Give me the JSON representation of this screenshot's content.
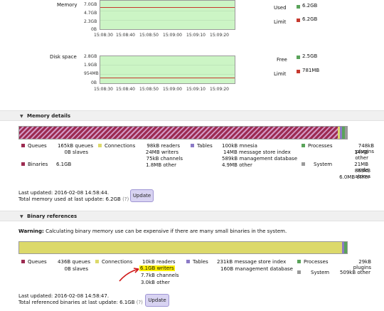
{
  "colors": {
    "queues": "#9c2b51",
    "binaries": "#9c2b51",
    "connections": "#dcd96a",
    "tables": "#8b7ac6",
    "processes": "#5aa35a",
    "system": "#9a9a9a",
    "plot_fill": "#ccf5c5",
    "limit_line": "#c6392e",
    "highlight": "#fff200",
    "arrow": "#d01818"
  },
  "memory_chart": {
    "label": "Memory",
    "yticks": [
      "7.0GB",
      "4.7GB",
      "2.3GB",
      "0B"
    ],
    "xticks": [
      "15:08:30",
      "15:08:40",
      "15:08:50",
      "15:09:00",
      "15:09:10",
      "15:09:20"
    ],
    "used_label": "Used",
    "used_value": "6.2GB",
    "limit_label": "Limit",
    "limit_value": "6.2GB"
  },
  "disk_chart": {
    "label": "Disk space",
    "yticks": [
      "2.8GB",
      "1.9GB",
      "954MB",
      "0B"
    ],
    "xticks": [
      "15:08:30",
      "15:08:40",
      "15:08:50",
      "15:09:00",
      "15:09:10",
      "15:09:20"
    ],
    "free_label": "Free",
    "free_value": "2.5GB",
    "limit_label": "Limit",
    "limit_value": "781MB"
  },
  "memory_details": {
    "title": "Memory details",
    "queues_label": "Queues",
    "queues_lines": [
      "165kB queues",
      "0B slaves"
    ],
    "binaries_label": "Binaries",
    "binaries_value": "6.1GB",
    "connections_label": "Connections",
    "connections_lines": [
      "98kB readers",
      "24MB writers",
      "75kB channels",
      "1.8MB other"
    ],
    "tables_label": "Tables",
    "tables_lines": [
      "100kB mnesia",
      "14MB message store index",
      "589kB management database",
      "4.9MB other"
    ],
    "processes_label": "Processes",
    "processes_lines": [
      "748kB plugins",
      "14MB other"
    ],
    "system_label": "System",
    "system_lines": [
      "21MB code",
      "863kB atoms",
      "6.0MB other"
    ],
    "last_updated": "Last updated: 2016-02-08 14:58:44.",
    "total_text": "Total memory used at last update: 6.2GB",
    "help": "(?)",
    "update_button": "Update"
  },
  "binary_refs": {
    "title": "Binary references",
    "warning_bold": "Warning:",
    "warning_text": "Calculating binary memory use can be expensive if there are many small binaries in the system.",
    "queues_label": "Queues",
    "queues_lines": [
      "436B queues",
      "0B slaves"
    ],
    "connections_label": "Connections",
    "connections_lines": [
      "10kB readers",
      "6.1GB writers",
      "7.7kB channels",
      "3.0kB other"
    ],
    "tables_label": "Tables",
    "tables_lines": [
      "231kB message store index",
      "160B management database"
    ],
    "processes_label": "Processes",
    "processes_lines": [
      "29kB plugins"
    ],
    "system_label": "System",
    "system_lines": [
      "509kB other"
    ],
    "last_updated": "Last updated: 2016-02-08 14:58:47.",
    "total_text": "Total referenced binaries at last update: 6.1GB",
    "help": "(?)",
    "update_button": "Update"
  }
}
